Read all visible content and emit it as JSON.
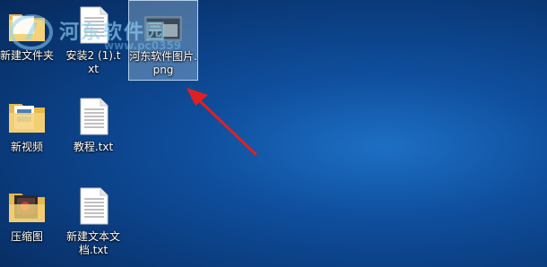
{
  "desktop": {
    "watermark": {
      "text": "河东软件园",
      "url": "www.pc0359"
    },
    "icons": [
      {
        "label": "新建文件夹",
        "icon": "folder-icon"
      },
      {
        "label": "安装2 (1).txt",
        "icon": "text-file-icon"
      },
      {
        "label": "河东软件图片.png",
        "icon": "image-file-icon",
        "selected": true
      },
      {
        "label": "新视频",
        "icon": "folder-video-icon"
      },
      {
        "label": "教程.txt",
        "icon": "text-file-icon"
      },
      {
        "label": "压缩图",
        "icon": "folder-image-icon"
      },
      {
        "label": "新建文本文档.txt",
        "icon": "text-file-icon"
      }
    ],
    "annotation": {
      "type": "arrow",
      "color": "#e02020"
    }
  }
}
